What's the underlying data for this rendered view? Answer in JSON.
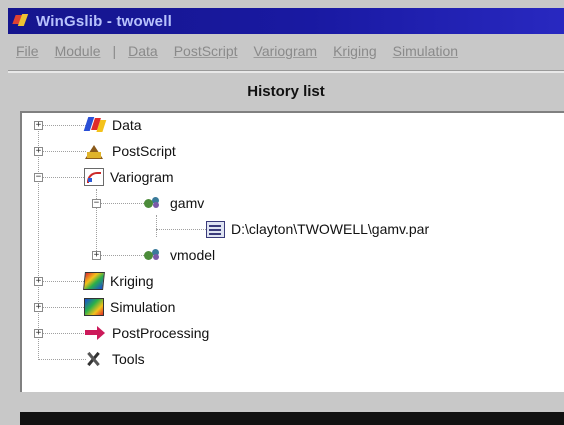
{
  "window": {
    "title": "WinGslib - twowell"
  },
  "menu": [
    {
      "label": "File"
    },
    {
      "label": "Module"
    },
    {
      "label": "Data"
    },
    {
      "label": "PostScript"
    },
    {
      "label": "Variogram"
    },
    {
      "label": "Kriging"
    },
    {
      "label": "Simulation"
    }
  ],
  "menu_separator": "|",
  "panel": {
    "header": "History list"
  },
  "tree": {
    "data": {
      "label": "Data",
      "icon": "data-icon",
      "state": "collapsed"
    },
    "postscript": {
      "label": "PostScript",
      "icon": "postscript-icon",
      "state": "collapsed"
    },
    "variogram": {
      "label": "Variogram",
      "icon": "variogram-icon",
      "state": "expanded"
    },
    "gamv": {
      "label": "gamv",
      "icon": "program-gear-icon",
      "state": "expanded"
    },
    "gamv_par": {
      "label": "D:\\clayton\\TWOWELL\\gamv.par",
      "icon": "parameter-file-icon"
    },
    "vmodel": {
      "label": "vmodel",
      "icon": "program-gear-icon",
      "state": "collapsed"
    },
    "kriging": {
      "label": "Kriging",
      "icon": "kriging-icon",
      "state": "collapsed"
    },
    "simulation": {
      "label": "Simulation",
      "icon": "simulation-icon",
      "state": "collapsed"
    },
    "postprocessing": {
      "label": "PostProcessing",
      "icon": "postprocessing-icon",
      "state": "collapsed"
    },
    "tools": {
      "label": "Tools",
      "icon": "tools-icon"
    }
  },
  "colors": {
    "titlebar": "#10109a",
    "panel_bg": "#ffffff",
    "window_bg": "#c8c8c8"
  }
}
